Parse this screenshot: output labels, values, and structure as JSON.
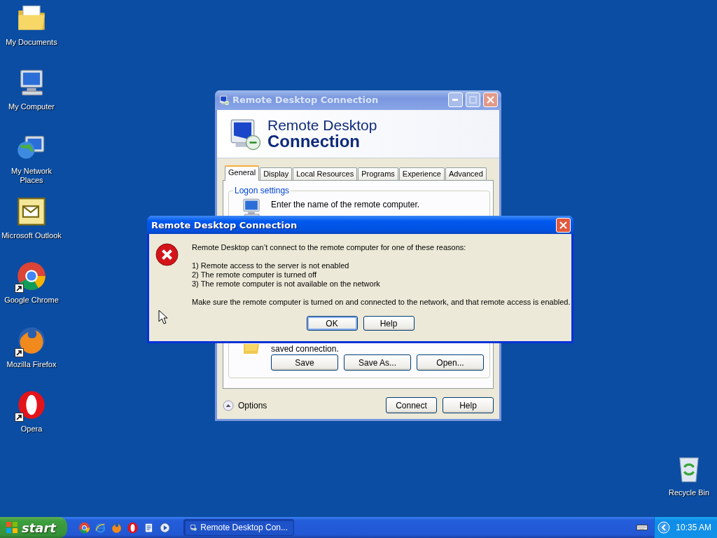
{
  "desktop_icons": [
    {
      "kind": "documents",
      "label": "My Documents",
      "shortcut": false
    },
    {
      "kind": "computer",
      "label": "My Computer",
      "shortcut": false
    },
    {
      "kind": "network",
      "label": "My Network Places",
      "shortcut": false
    },
    {
      "kind": "outlook",
      "label": "Microsoft Outlook",
      "shortcut": false
    },
    {
      "kind": "chrome",
      "label": "Google Chrome",
      "shortcut": true
    },
    {
      "kind": "firefox",
      "label": "Mozilla Firefox",
      "shortcut": true
    },
    {
      "kind": "opera",
      "label": "Opera",
      "shortcut": true
    }
  ],
  "recycle_bin": {
    "label": "Recycle Bin"
  },
  "main_window": {
    "title": "Remote Desktop Connection",
    "banner_line1": "Remote Desktop",
    "banner_line2": "Connection",
    "tabs": [
      {
        "label": "General",
        "selected": true
      },
      {
        "label": "Display",
        "selected": false
      },
      {
        "label": "Local Resources",
        "selected": false
      },
      {
        "label": "Programs",
        "selected": false
      },
      {
        "label": "Experience",
        "selected": false
      },
      {
        "label": "Advanced",
        "selected": false
      }
    ],
    "group_title": "Logon settings",
    "instruction": "Enter the name of the remote computer.",
    "save_text": "saved connection.",
    "save_buttons": [
      "Save",
      "Save As...",
      "Open..."
    ],
    "options": "Options",
    "buttons": [
      "Connect",
      "Help"
    ]
  },
  "error_dialog": {
    "title": "Remote Desktop Connection",
    "message": "Remote Desktop can’t connect to the remote computer for one of these reasons:",
    "reasons": [
      "1) Remote access to the server is not enabled",
      "2) The remote computer is turned off",
      "3) The remote computer is not available on the network"
    ],
    "advice": "Make sure the remote computer is turned on and connected to the network, and that remote access is enabled.",
    "buttons": [
      {
        "label": "OK",
        "default": true
      },
      {
        "label": "Help",
        "default": false
      }
    ]
  },
  "taskbar": {
    "start": "start",
    "quick_launch": [
      {
        "kind": "chrome"
      },
      {
        "kind": "ie"
      },
      {
        "kind": "firefox"
      },
      {
        "kind": "opera"
      },
      {
        "kind": "notepad"
      },
      {
        "kind": "media"
      }
    ],
    "task": "Remote Desktop Con...",
    "clock": "10:35 AM"
  }
}
